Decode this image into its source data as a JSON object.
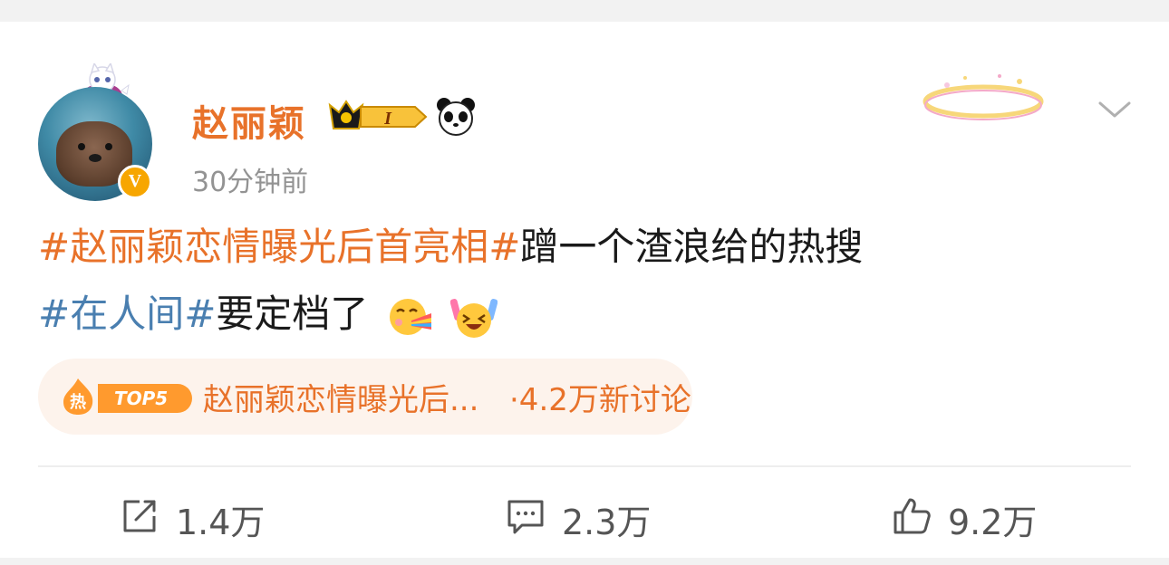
{
  "post": {
    "author": "赵丽颖",
    "member_badge_text": "I",
    "timestamp": "30分钟前",
    "line1": {
      "hashtag": "#赵丽颖恋情曝光后首亮相#",
      "text": "蹭一个渣浪给的热搜"
    },
    "line2": {
      "hashtag": "#在人间#",
      "text": "要定档了"
    },
    "emojis": [
      "rainbow-vomit-emoji",
      "cheering-emoji"
    ]
  },
  "hot_search": {
    "hot_char": "热",
    "rank_label": "TOP5",
    "title": "赵丽颖恋情曝光后...",
    "discussion": "·4.2万新讨论"
  },
  "actions": {
    "repost_count": "1.4万",
    "comment_count": "2.3万",
    "like_count": "9.2万"
  },
  "icons": {
    "repost": "repost-icon",
    "comment": "comment-icon",
    "like": "thumbs-up-icon",
    "more": "chevron-down-icon",
    "verified": "verified-v-icon",
    "panda": "panda-icon"
  },
  "colors": {
    "accent_orange": "#e8722a",
    "hashtag_blue": "#4a7fb0",
    "verified_gold": "#f7a600",
    "hot_pill_bg": "#fdf3ec"
  }
}
